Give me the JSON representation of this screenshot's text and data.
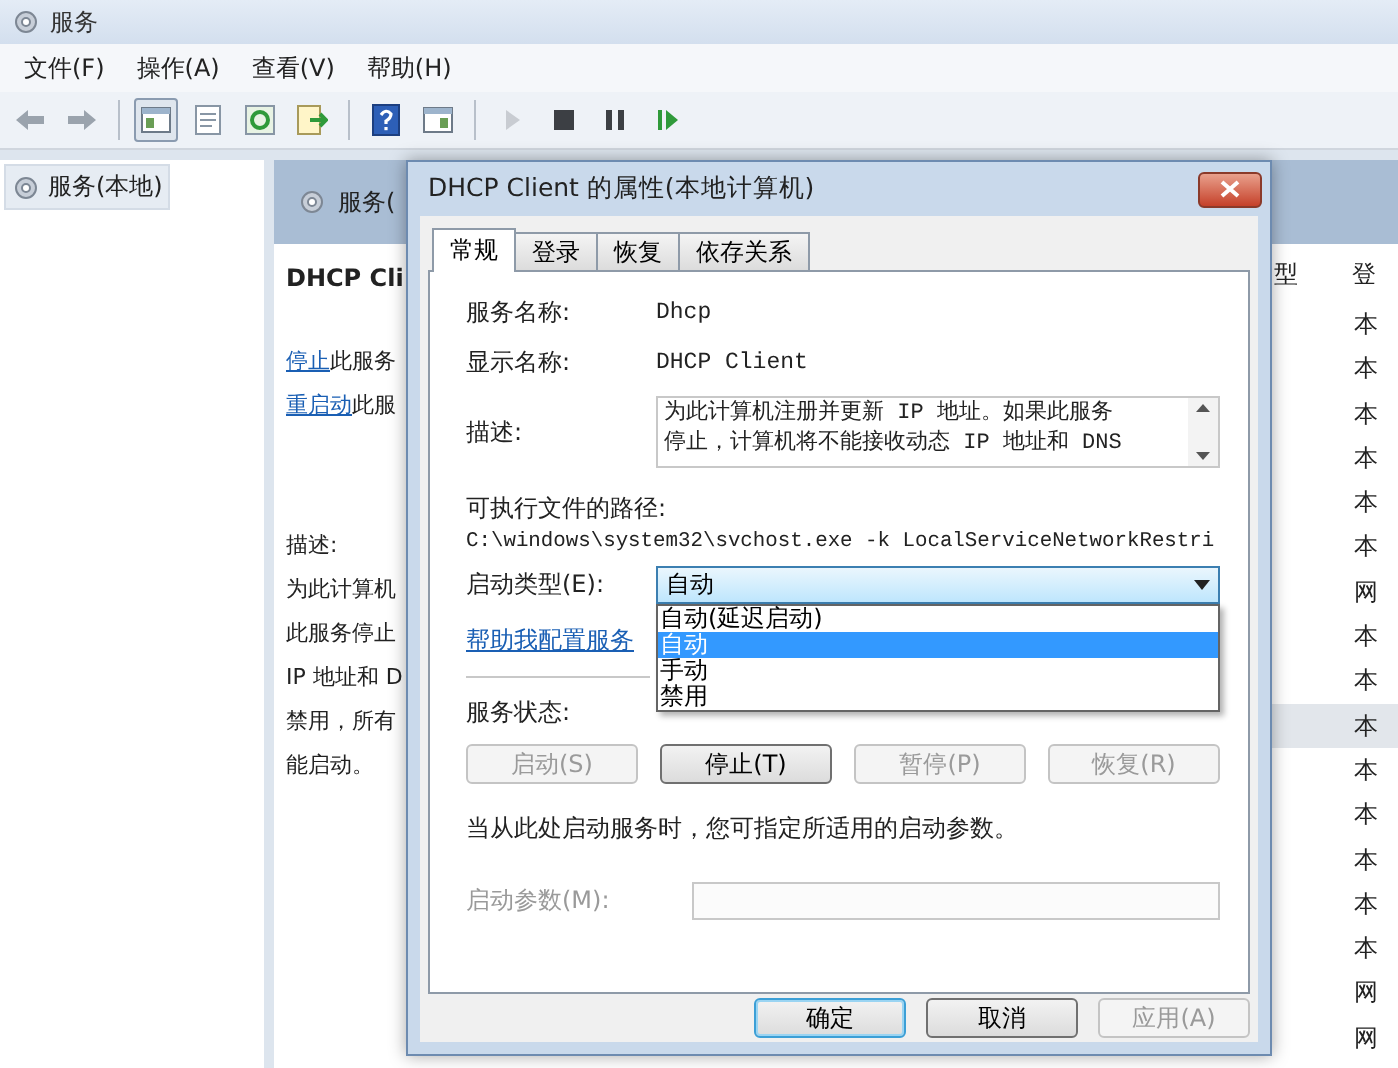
{
  "window": {
    "title": "服务"
  },
  "menu": [
    "文件(F)",
    "操作(A)",
    "查看(V)",
    "帮助(H)"
  ],
  "tree": {
    "items": [
      {
        "label": "服务(本地)",
        "selected": true
      }
    ]
  },
  "pane": {
    "header": "服务(",
    "service_name": "DHCP Cli",
    "actions": [
      {
        "link": "停止",
        "text": "此服务"
      },
      {
        "link": "重启动",
        "text": "此服"
      }
    ],
    "description_label": "描述:",
    "description_lines": [
      "为此计算机",
      "此服务停止",
      "IP 地址和 D",
      "禁用，所有",
      "能启动。"
    ]
  },
  "list": {
    "columns": [
      "型",
      "登"
    ],
    "rows": [
      {
        "logon": "本",
        "selected": false
      },
      {
        "logon": "本",
        "selected": false
      },
      {
        "logon": "本",
        "selected": false
      },
      {
        "logon": "本",
        "selected": false
      },
      {
        "logon": "本",
        "selected": false
      },
      {
        "logon": "本",
        "selected": false
      },
      {
        "logon": "网",
        "selected": false
      },
      {
        "logon": "本",
        "selected": false
      },
      {
        "logon": "本",
        "selected": false
      },
      {
        "logon": "本",
        "selected": true
      },
      {
        "logon": "本",
        "selected": false
      },
      {
        "logon": "本",
        "selected": false
      },
      {
        "logon": "本",
        "selected": false
      },
      {
        "logon": "本",
        "selected": false
      },
      {
        "logon": "本",
        "selected": false
      },
      {
        "logon": "网",
        "selected": false
      },
      {
        "logon": "网",
        "selected": false
      }
    ]
  },
  "dialog": {
    "title": "DHCP Client 的属性(本地计算机)",
    "tabs": [
      {
        "label": "常规",
        "selected": true
      },
      {
        "label": "登录",
        "selected": false
      },
      {
        "label": "恢复",
        "selected": false
      },
      {
        "label": "依存关系",
        "selected": false
      }
    ],
    "service_name": {
      "label": "服务名称:",
      "value": "Dhcp"
    },
    "display_name": {
      "label": "显示名称:",
      "value": "DHCP Client"
    },
    "description": {
      "label": "描述:",
      "lines": [
        "为此计算机注册并更新 IP 地址。如果此服务",
        "停止，计算机将不能接收动态 IP 地址和 DNS"
      ]
    },
    "path": {
      "label": "可执行文件的路径:",
      "value": "C:\\windows\\system32\\svchost.exe -k LocalServiceNetworkRestri"
    },
    "startup_type": {
      "label": "启动类型(E):",
      "value": "自动",
      "expanded": true,
      "options": [
        {
          "label": "自动(延迟启动)",
          "selected": false
        },
        {
          "label": "自动",
          "selected": true
        },
        {
          "label": "手动",
          "selected": false
        },
        {
          "label": "禁用",
          "selected": false
        }
      ]
    },
    "help_link": "帮助我配置服务",
    "status_label": "服务状态:",
    "service_buttons": [
      {
        "label": "启动(S)",
        "disabled": true
      },
      {
        "label": "停止(T)",
        "disabled": false
      },
      {
        "label": "暂停(P)",
        "disabled": true
      },
      {
        "label": "恢复(R)",
        "disabled": true
      }
    ],
    "hint": "当从此处启动服务时，您可指定所适用的启动参数。",
    "parameters": {
      "label": "启动参数(M):",
      "disabled": true
    },
    "buttons": [
      {
        "label": "确定",
        "default": true,
        "disabled": false
      },
      {
        "label": "取消",
        "default": false,
        "disabled": false
      },
      {
        "label": "应用(A)",
        "default": false,
        "disabled": true
      }
    ]
  }
}
